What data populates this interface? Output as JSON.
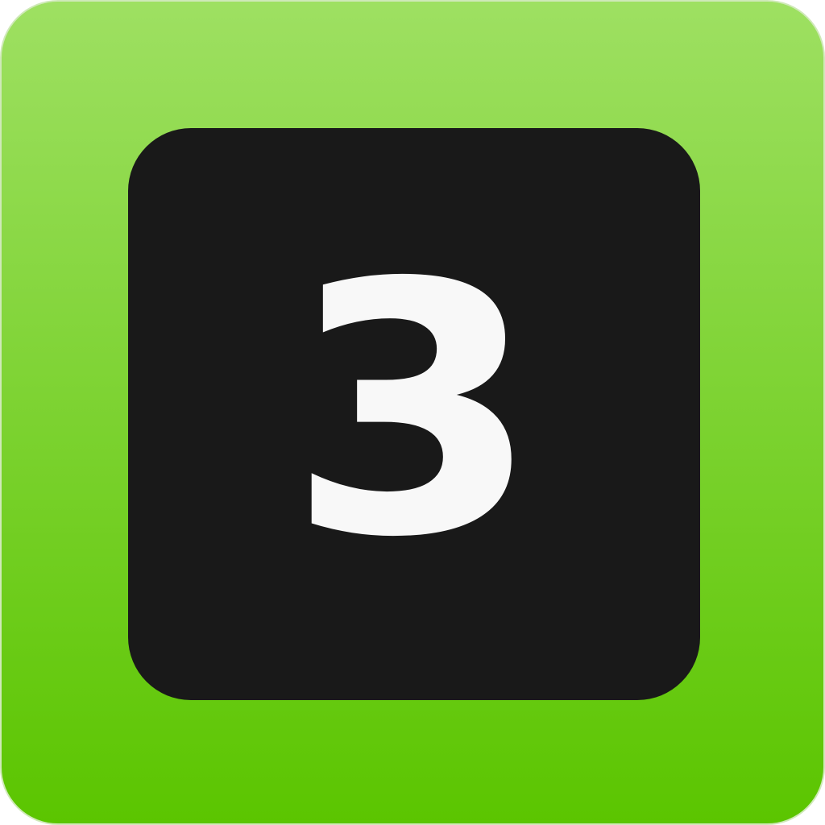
{
  "icon": {
    "digit": "3",
    "colors": {
      "background_top": "#9ee062",
      "background_bottom": "#5bc500",
      "tile": "#191919",
      "digit": "#f8f8f8"
    }
  }
}
